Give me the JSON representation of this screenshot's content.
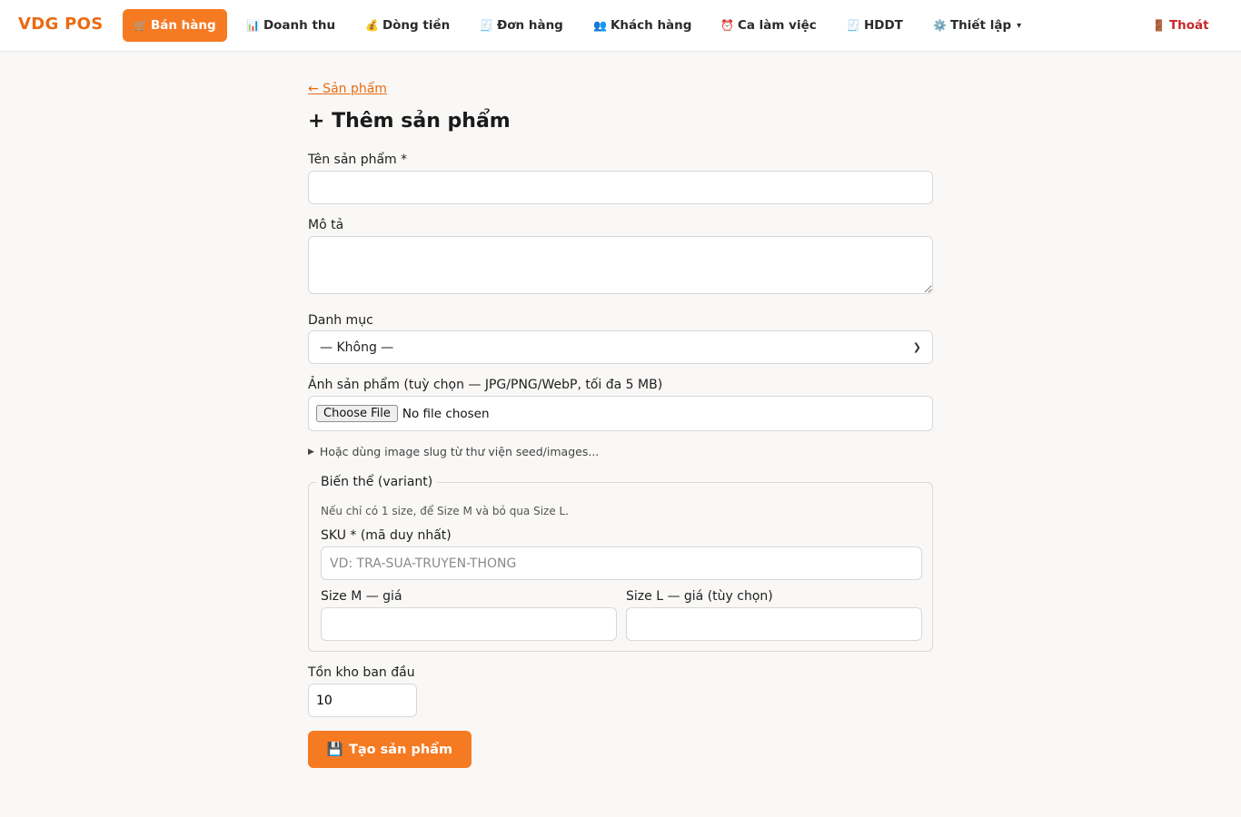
{
  "nav": {
    "brand": "VDG POS",
    "items": [
      {
        "icon": "🛒",
        "label": "Bán hàng",
        "active": true
      },
      {
        "icon": "📊",
        "label": "Doanh thu"
      },
      {
        "icon": "💰",
        "label": "Dòng tiền"
      },
      {
        "icon": "🧾",
        "label": "Đơn hàng"
      },
      {
        "icon": "👥",
        "label": "Khách hàng"
      },
      {
        "icon": "⏰",
        "label": "Ca làm việc"
      },
      {
        "icon": "🧾",
        "label": "HDDT"
      },
      {
        "icon": "⚙️",
        "label": "Thiết lập",
        "caret": "▾"
      }
    ],
    "logout": {
      "icon": "🚪",
      "label": "Thoát"
    }
  },
  "form": {
    "back_link": "← Sản phẩm",
    "title": "+ Thêm sản phẩm",
    "name_label": "Tên sản phẩm *",
    "name_value": "",
    "description_label": "Mô tả",
    "category_label": "Danh mục",
    "category_selected": "— Không —",
    "image_label": "Ảnh sản phẩm (tuỳ chọn — JPG/PNG/WebP, tối đa 5 MB)",
    "file_button": "Choose File",
    "file_status": "No file chosen",
    "slug_toggle": "Hoặc dùng image slug từ thư viện seed/images...",
    "variant": {
      "legend": "Biến thể (variant)",
      "hint": "Nếu chỉ có 1 size, để Size M và bỏ qua Size L.",
      "sku_label": "SKU * (mã duy nhất)",
      "sku_placeholder": "VD: TRA-SUA-TRUYEN-THONG",
      "size_m_label": "Size M — giá",
      "size_l_label": "Size L — giá (tùy chọn)"
    },
    "stock_label": "Tồn kho ban đầu",
    "stock_value": "10",
    "submit": {
      "icon": "💾",
      "label": "Tạo sản phẩm"
    }
  },
  "colors": {
    "accent": "#f57a22",
    "brand": "#ea6a12",
    "logout": "#c62828"
  }
}
